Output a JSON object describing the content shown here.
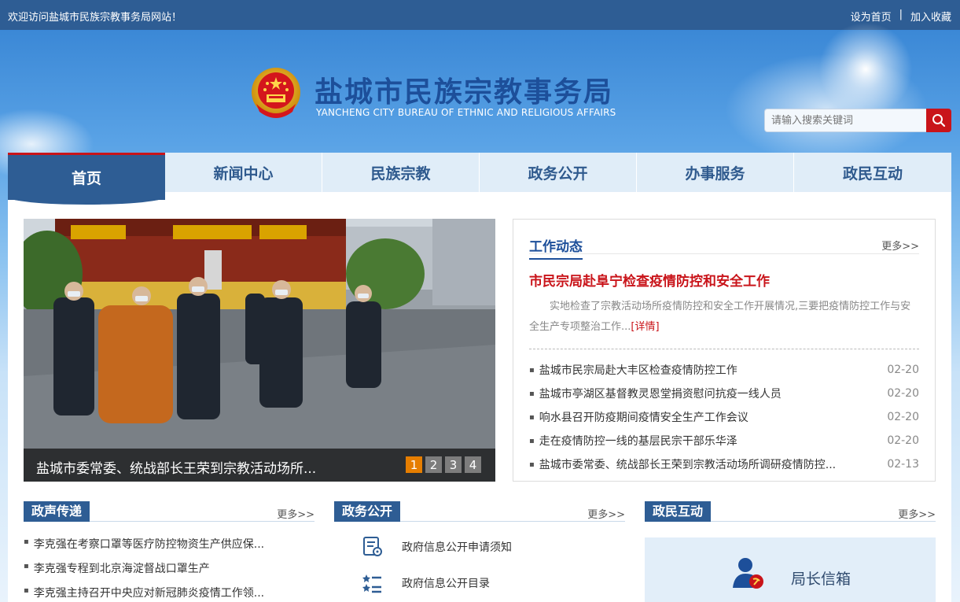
{
  "topbar": {
    "welcome": "欢迎访问盐城市民族宗教事务局网站！",
    "set_home": "设为首页",
    "divider": "|",
    "add_favorite": "加入收藏"
  },
  "header": {
    "title": "盐城市民族宗教事务局",
    "subtitle": "YANCHENG CITY BUREAU OF ETHNIC AND RELIGIOUS AFFAIRS",
    "search_placeholder": "请输入搜索关键词"
  },
  "nav": {
    "items": [
      {
        "label": "首页"
      },
      {
        "label": "新闻中心"
      },
      {
        "label": "民族宗教"
      },
      {
        "label": "政务公开"
      },
      {
        "label": "办事服务"
      },
      {
        "label": "政民互动"
      }
    ],
    "active_index": 0
  },
  "slideshow": {
    "caption": "盐城市委常委、统战部长王荣到宗教活动场所...",
    "pages": [
      "1",
      "2",
      "3",
      "4"
    ],
    "active_page": 1
  },
  "work_news": {
    "title": "工作动态",
    "more": "更多>>",
    "headline": "市民宗局赴阜宁检查疫情防控和安全工作",
    "summary": "实地检查了宗教活动场所疫情防控和安全工作开展情况,三要把疫情防控工作与安全生产专项整治工作...",
    "detail_link": "[详情]",
    "items": [
      {
        "title": "盐城市民宗局赴大丰区检查疫情防控工作",
        "date": "02-20"
      },
      {
        "title": "盐城市亭湖区基督教灵恩堂捐资慰问抗疫一线人员",
        "date": "02-20"
      },
      {
        "title": "响水县召开防疫期间疫情安全生产工作会议",
        "date": "02-20"
      },
      {
        "title": "走在疫情防控一线的基层民宗干部乐华泽",
        "date": "02-20"
      },
      {
        "title": "盐城市委常委、统战部长王荣到宗教活动场所调研疫情防控...",
        "date": "02-13"
      }
    ]
  },
  "gov_voice": {
    "title": "政声传递",
    "more": "更多>>",
    "items": [
      "李克强在考察口罩等医疗防控物资生产供应保...",
      "李克强专程到北京海淀督战口罩生产",
      "李克强主持召开中央应对新冠肺炎疫情工作领..."
    ]
  },
  "gov_open": {
    "title": "政务公开",
    "more": "更多>>",
    "items": [
      {
        "label": "政府信息公开申请须知",
        "icon": "document-icon"
      },
      {
        "label": "政府信息公开目录",
        "icon": "list-icon"
      }
    ]
  },
  "interaction": {
    "title": "政民互动",
    "more": "更多>>",
    "mailbox_label": "局长信箱"
  },
  "colors": {
    "primary_blue": "#2e5d94",
    "accent_red": "#c9141a",
    "nav_bg": "#e0edf8",
    "active_page": "#e67e00"
  }
}
